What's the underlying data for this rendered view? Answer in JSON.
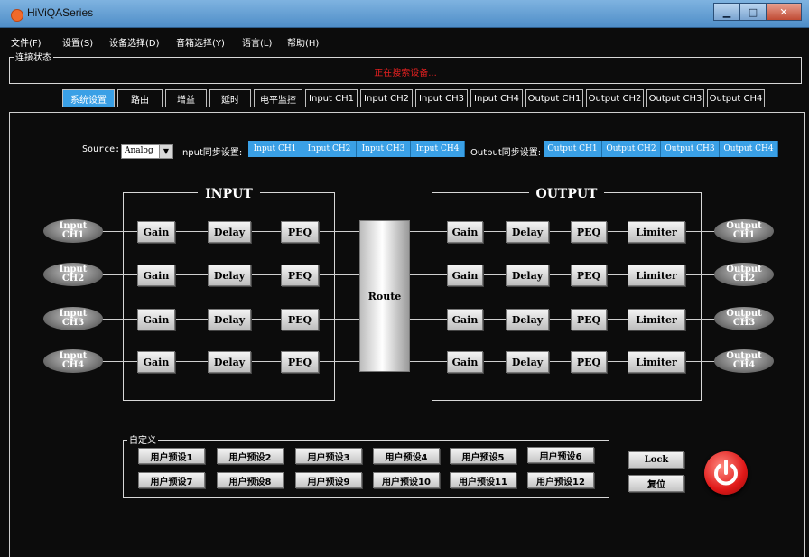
{
  "window": {
    "title": "HiViQASeries",
    "minimize": "▁",
    "maximize": "□",
    "close": "✕"
  },
  "menu": [
    "文件(F)",
    "设置(S)",
    "设备选择(D)",
    "音箱选择(Y)",
    "语言(L)",
    "帮助(H)"
  ],
  "status": {
    "label": "连接状态",
    "text": "正在搜索设备..."
  },
  "tabs": [
    "系统设置",
    "路由",
    "增益",
    "延时",
    "电平监控",
    "Input CH1",
    "Input CH2",
    "Input CH3",
    "Input CH4",
    "Output CH1",
    "Output CH2",
    "Output CH3",
    "Output CH4"
  ],
  "active_tab": "系统设置",
  "source": {
    "label": "Source:",
    "value": "Analog"
  },
  "input_sync": {
    "label": "Input同步设置:",
    "buttons": [
      "Input CH1",
      "Input CH2",
      "Input CH3",
      "Input CH4"
    ]
  },
  "output_sync": {
    "label": "Output同步设置:",
    "buttons": [
      "Output CH1",
      "Output CH2",
      "Output CH3",
      "Output CH4"
    ]
  },
  "input_group": {
    "title": "INPUT"
  },
  "output_group": {
    "title": "OUTPUT"
  },
  "inputs": [
    {
      "l1": "Input",
      "l2": "CH1"
    },
    {
      "l1": "Input",
      "l2": "CH2"
    },
    {
      "l1": "Input",
      "l2": "CH3"
    },
    {
      "l1": "Input",
      "l2": "CH4"
    }
  ],
  "outputs": [
    {
      "l1": "Output",
      "l2": "CH1"
    },
    {
      "l1": "Output",
      "l2": "CH2"
    },
    {
      "l1": "Output",
      "l2": "CH3"
    },
    {
      "l1": "Output",
      "l2": "CH4"
    }
  ],
  "modules": {
    "gain": "Gain",
    "delay": "Delay",
    "peq": "PEQ",
    "limiter": "Limiter",
    "route": "Route"
  },
  "presets": {
    "label": "自定义",
    "items": [
      "用户预设1",
      "用户预设2",
      "用户预设3",
      "用户预设4",
      "用户预设5",
      "用户预设6",
      "用户预设7",
      "用户预设8",
      "用户预设9",
      "用户预设10",
      "用户预设11",
      "用户预设12"
    ]
  },
  "buttons": {
    "lock": "Lock",
    "reset": "复位"
  },
  "colors": {
    "accent": "#3aa0e6",
    "status_text": "#e02020",
    "power": "#e01818"
  },
  "icons": {
    "power": "power-icon",
    "app": "app-icon"
  }
}
